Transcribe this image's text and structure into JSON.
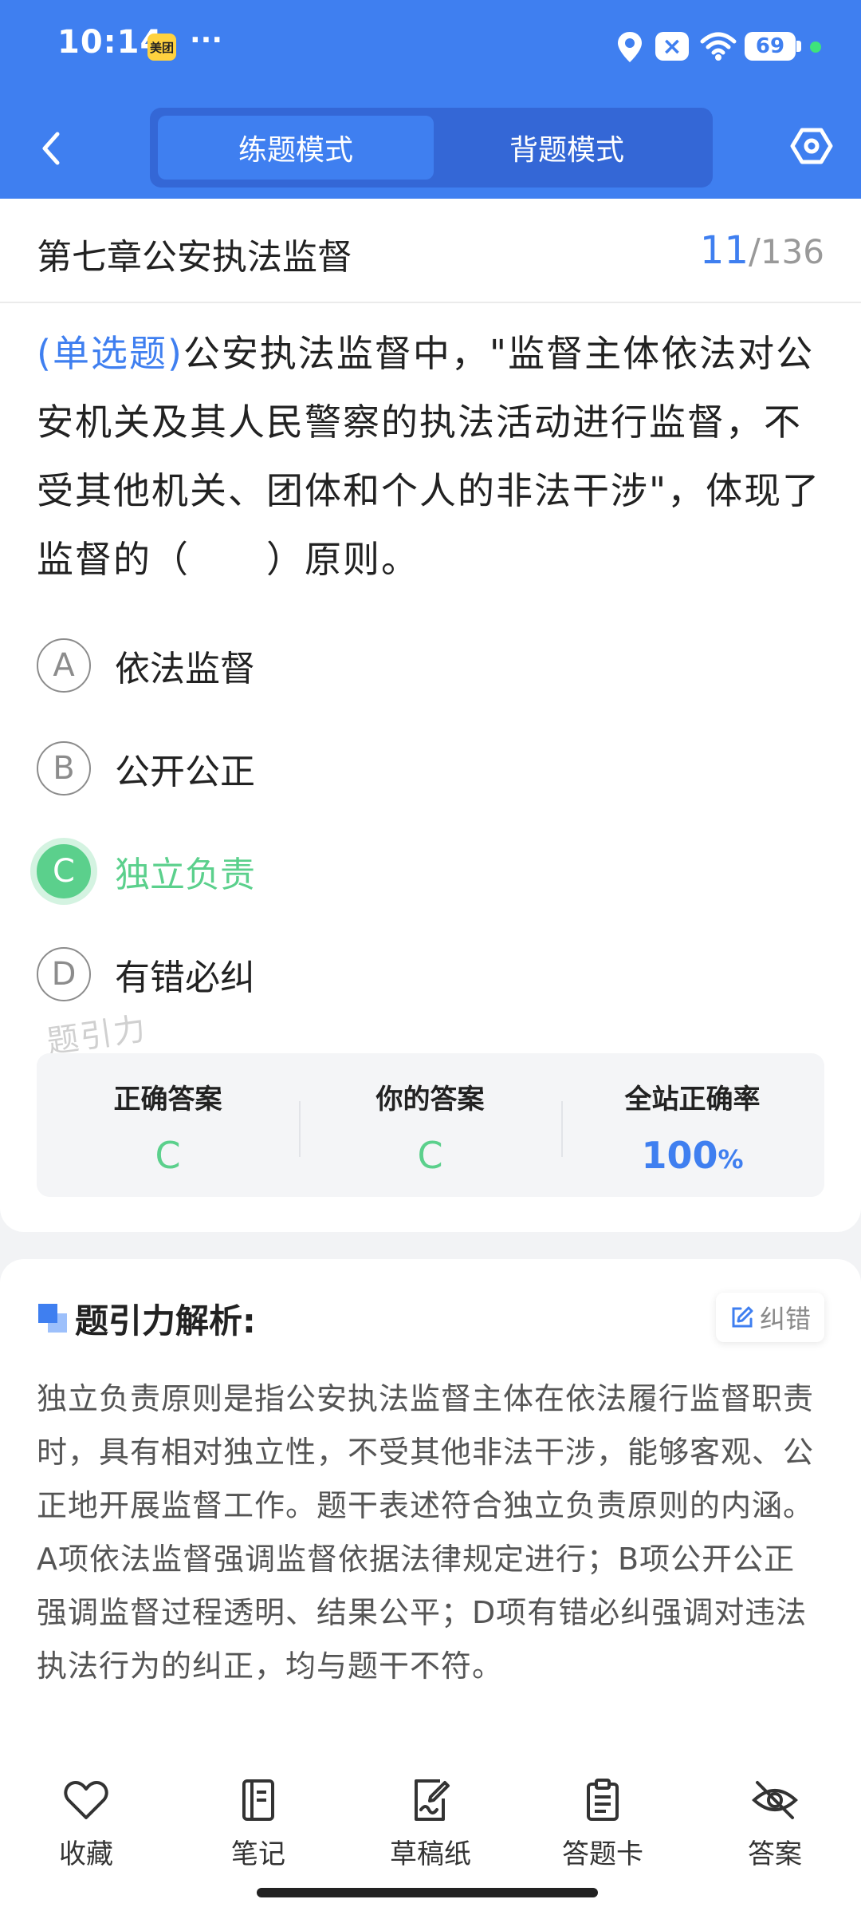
{
  "status_bar": {
    "time": "10:14",
    "app_badge": "美团",
    "more": "···",
    "battery": "69",
    "icons": [
      "location-icon",
      "notification-close-icon",
      "wifi-icon",
      "battery-icon"
    ]
  },
  "header": {
    "tabs": [
      {
        "label": "练题模式",
        "active": true
      },
      {
        "label": "背题模式",
        "active": false
      }
    ],
    "icons": [
      "back-arrow-icon",
      "settings-icon"
    ]
  },
  "chapter": {
    "title": "第七章公安执法监督",
    "current": "11",
    "separator": "/",
    "total": "136"
  },
  "question": {
    "type_tag": "(单选题)",
    "text": "公安执法监督中，\"监督主体依法对公安机关及其人民警察的执法活动进行监督，不受其他机关、团体和个人的非法干涉\"，体现了监督的（　　）原则。"
  },
  "options": [
    {
      "letter": "A",
      "text": "依法监督",
      "state": "normal"
    },
    {
      "letter": "B",
      "text": "公开公正",
      "state": "normal"
    },
    {
      "letter": "C",
      "text": "独立负责",
      "state": "correct"
    },
    {
      "letter": "D",
      "text": "有错必纠",
      "state": "normal"
    }
  ],
  "watermark": "题引力",
  "answer_panel": {
    "correct_label": "正确答案",
    "correct_value": "C",
    "yours_label": "你的答案",
    "yours_value": "C",
    "rate_label": "全站正确率",
    "rate_value": "100",
    "rate_unit": "%"
  },
  "analysis": {
    "title": "题引力解析:",
    "fix_label": "纠错",
    "text": "独立负责原则是指公安执法监督主体在依法履行监督职责时，具有相对独立性，不受其他非法干涉，能够客观、公正地开展监督工作。题干表述符合独立负责原则的内涵。A项依法监督强调监督依据法律规定进行；B项公开公正强调监督过程透明、结果公平；D项有错必纠强调对违法执法行为的纠正，均与题干不符。"
  },
  "bottom_nav": [
    {
      "label": "收藏",
      "icon": "heart-icon"
    },
    {
      "label": "笔记",
      "icon": "notebook-icon"
    },
    {
      "label": "草稿纸",
      "icon": "draft-paper-icon"
    },
    {
      "label": "答题卡",
      "icon": "answer-card-icon"
    },
    {
      "label": "答案",
      "icon": "eye-off-icon"
    }
  ],
  "colors": {
    "primary": "#3f7ff0",
    "correct": "#5bd08c"
  }
}
